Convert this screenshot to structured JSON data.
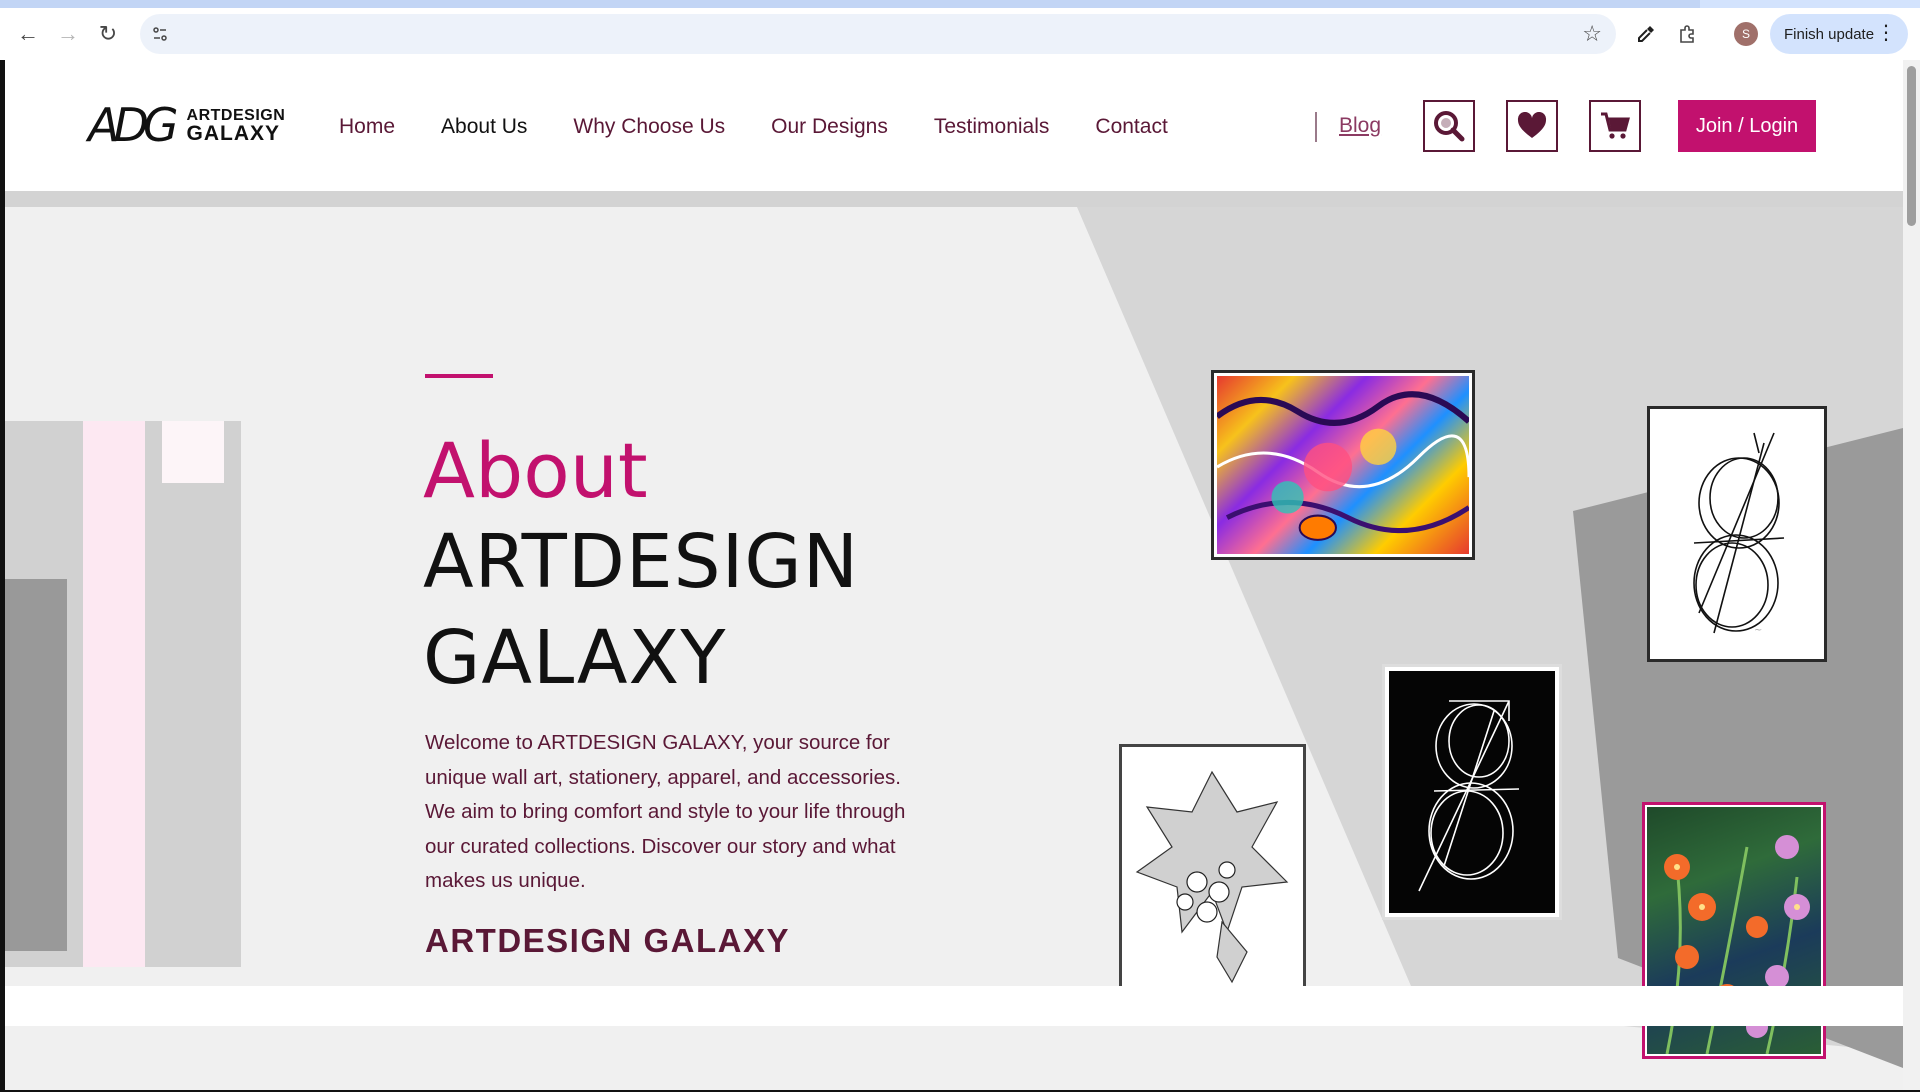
{
  "browser": {
    "address": "",
    "finish_update_label": "Finish update",
    "profile_initial": "S"
  },
  "site": {
    "logo_mark": "ADG",
    "logo_line1": "ARTDESIGN",
    "logo_line2": "GALAXY",
    "nav": [
      "Home",
      "About Us",
      "Why Choose Us",
      "Our Designs",
      "Testimonials",
      "Contact"
    ],
    "active_nav": "About Us",
    "blog": "Blog",
    "join_label": "Join / Login"
  },
  "hero": {
    "about": "About",
    "title_line1": "ARTDESIGN",
    "title_line2": "GALAXY",
    "description": "Welcome to ARTDESIGN GALAXY, your source for unique wall art, stationery, apparel, and accessories. We aim to bring comfort and style to your life through our curated collections. Discover our story and what makes us unique.",
    "brand": "ARTDESIGN GALAXY"
  },
  "colors": {
    "accent": "#c2116e",
    "plum": "#5a1836",
    "hero_bg": "#f0f0f0"
  }
}
